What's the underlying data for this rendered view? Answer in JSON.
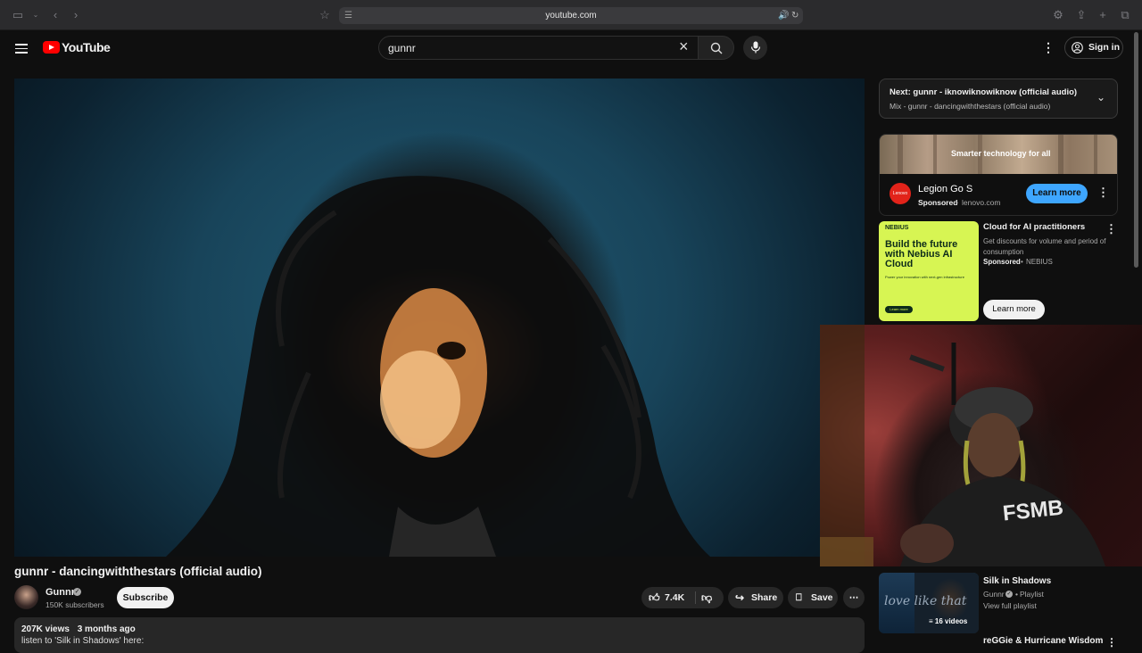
{
  "browser": {
    "url": "youtube.com"
  },
  "header": {
    "logo_text": "YouTube",
    "search_value": "gunnr",
    "sign_in": "Sign in"
  },
  "video": {
    "title": "gunnr - dancingwiththestars (official audio)",
    "channel": "Gunnr",
    "subscribers": "150K subscribers",
    "subscribe_label": "Subscribe",
    "likes": "7.4K",
    "share_label": "Share",
    "save_label": "Save",
    "views": "207K views",
    "age": "3 months ago",
    "desc_line": "listen to 'Silk in Shadows' here:"
  },
  "next": {
    "title": "Next: gunnr - iknowiknowiknow (official audio)",
    "subtitle": "Mix - gunnr - dancingwiththestars (official audio)"
  },
  "ad1": {
    "banner_text": "Smarter technology for all",
    "name": "Legion Go S",
    "sponsored": "Sponsored",
    "domain": "lenovo.com",
    "cta": "Learn more",
    "logo_text": "Lenovo"
  },
  "ad2": {
    "brand": "NEBIUS",
    "headline": "Build the future with Nebius AI Cloud",
    "fine": "Power your innovation with next-gen infrastructure",
    "thumb_btn": "Learn more",
    "title": "Cloud for AI practitioners",
    "desc": "Get discounts for volume and period of consumption",
    "sponsored": "Sponsored",
    "advertiser": "NEBIUS",
    "cta": "Learn more"
  },
  "playlist": {
    "title": "Silk in Shadows",
    "channel": "Gunnr",
    "type": "Playlist",
    "link": "View full playlist",
    "count": "16 videos",
    "thumb_text": "love like that"
  },
  "next_item": {
    "title": "reGGie & Hurricane Wisdom"
  },
  "webcam": {
    "shirt_text": "FSMB"
  }
}
